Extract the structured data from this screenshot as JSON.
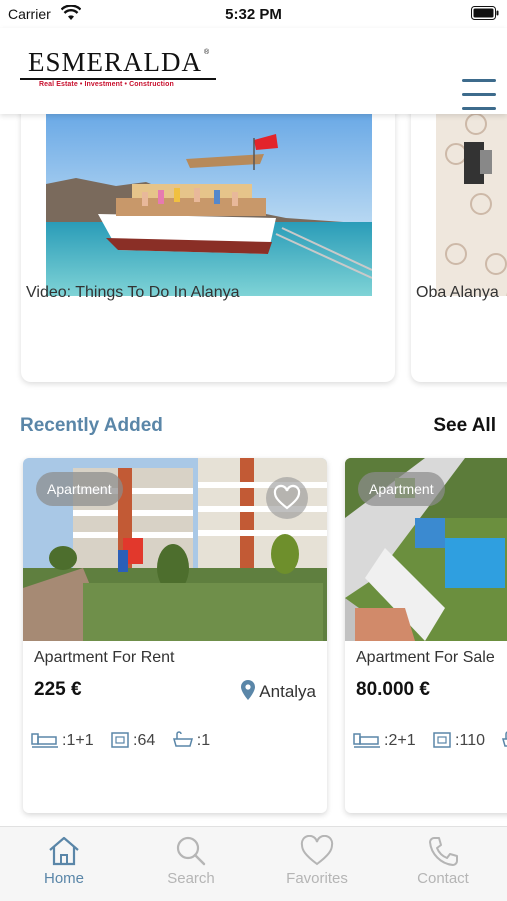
{
  "status_bar": {
    "carrier": "Carrier",
    "time": "5:32 PM"
  },
  "header": {
    "logo_name": "ESMERALDA",
    "logo_reg": "®",
    "logo_tagline": "Real Estate • Investment • Construction"
  },
  "videos": [
    {
      "title": "Video: Things To Do In Alanya"
    },
    {
      "title": "Oba Alanya"
    }
  ],
  "recent": {
    "title": "Recently Added",
    "see_all": "See All"
  },
  "properties": [
    {
      "type": "Apartment",
      "title": "Apartment For Rent",
      "price": "225 €",
      "location": "Antalya",
      "rooms": ":1+1",
      "area": ":64",
      "baths": ":1"
    },
    {
      "type": "Apartment",
      "title": "Apartment For Sale",
      "price": "80.000 €",
      "location": "",
      "rooms": ":2+1",
      "area": ":110",
      "baths": ""
    }
  ],
  "tabs": [
    {
      "label": "Home",
      "icon": "home-icon",
      "active": true
    },
    {
      "label": "Search",
      "icon": "search-icon",
      "active": false
    },
    {
      "label": "Favorites",
      "icon": "heart-icon",
      "active": false
    },
    {
      "label": "Contact",
      "icon": "phone-icon",
      "active": false
    }
  ],
  "colors": {
    "accent": "#5a86a8",
    "brand_red": "#c8102e",
    "inactive": "#b5b5b5"
  }
}
